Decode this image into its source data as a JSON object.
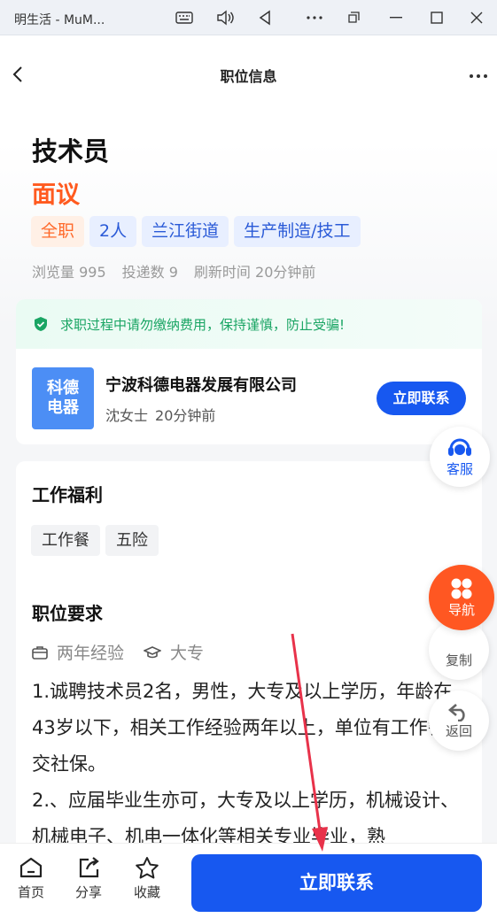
{
  "window": {
    "title": "明生活 - MuM..."
  },
  "header": {
    "title": "职位信息"
  },
  "job": {
    "title": "技术员",
    "salary": "面议",
    "tags": [
      "全职",
      "2人",
      "兰江街道",
      "生产制造/技工"
    ],
    "stats": {
      "views": "浏览量 995",
      "applications": "投递数 9",
      "refresh": "刷新时间 20分钟前"
    }
  },
  "notice": "求职过程中请勿缴纳费用，保持谨慎，防止受骗!",
  "company": {
    "logo_line1": "科德",
    "logo_line2": "电器",
    "name": "宁波科德电器发展有限公司",
    "contact_person": "沈女士",
    "contact_time": "20分钟前",
    "contact_button": "立即联系"
  },
  "benefits": {
    "title": "工作福利",
    "items": [
      "工作餐",
      "五险"
    ]
  },
  "requirements": {
    "title": "职位要求",
    "experience": "两年经验",
    "education": "大专",
    "description": "1.诚聘技术员2名，男性，大专及以上学历，年龄在43岁以下，相关工作经验两年以上，单位有工作餐。交社保。\n2.、应届毕业生亦可，大专及以上学历，机械设计、机械电子、机电一体化等相关专业毕业，熟"
  },
  "floating": {
    "service": "客服",
    "nav": "导航",
    "copy": "复制",
    "back": "返回"
  },
  "bottom": {
    "home": "首页",
    "share": "分享",
    "favorite": "收藏",
    "contact_button": "立即联系"
  },
  "colors": {
    "primary": "#1758f0",
    "accent": "#ff5a1f",
    "notice": "#1aa564"
  }
}
